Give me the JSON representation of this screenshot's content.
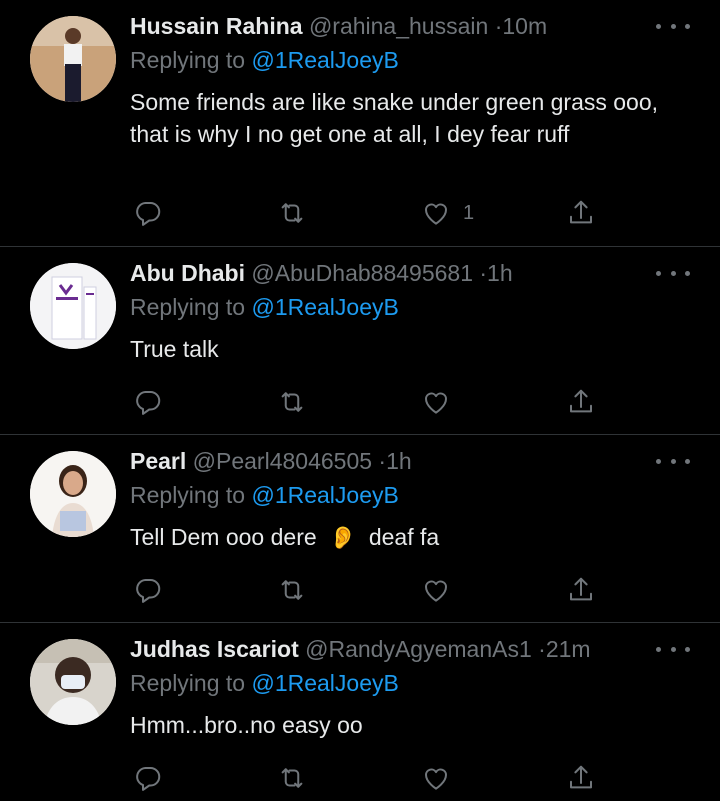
{
  "tweets": [
    {
      "name": "Hussain Rahina",
      "handle": "@rahina_hussain",
      "time": "10m",
      "reply_prefix": "Replying to",
      "reply_to": "@1RealJoeyB",
      "text": "Some friends are like snake under green grass ooo, that is why I no get one at all, I dey fear ruff",
      "likes": "1",
      "avatar_icon": "woman-standing-outdoors-avatar"
    },
    {
      "name": "Abu Dhabi",
      "handle": "@AbuDhab88495681",
      "time": "1h",
      "reply_prefix": "Replying to",
      "reply_to": "@1RealJoeyB",
      "text": "True talk",
      "likes": "",
      "avatar_icon": "cream-product-box-avatar"
    },
    {
      "name": "Pearl",
      "handle": "@Pearl48046505",
      "time": "1h",
      "reply_prefix": "Replying to",
      "reply_to": "@1RealJoeyB",
      "text_before": "Tell Dem ooo dere",
      "emoji": "👂",
      "text_after": "deaf fa",
      "likes": "",
      "avatar_icon": "woman-portrait-avatar"
    },
    {
      "name": "Judhas Iscariot",
      "handle": "@RandyAgyemanAs1",
      "time": "21m",
      "reply_prefix": "Replying to",
      "reply_to": "@1RealJoeyB",
      "text": "Hmm...bro..no easy oo",
      "likes": "",
      "avatar_icon": "man-with-face-mask-avatar"
    }
  ],
  "colors": {
    "background": "#000000",
    "text": "#e7e9ea",
    "secondary": "#71767b",
    "link": "#1d9bf0",
    "divider": "#2f3336"
  },
  "icons": [
    "reply-icon",
    "retweet-icon",
    "like-icon",
    "share-icon",
    "more-options-icon"
  ]
}
